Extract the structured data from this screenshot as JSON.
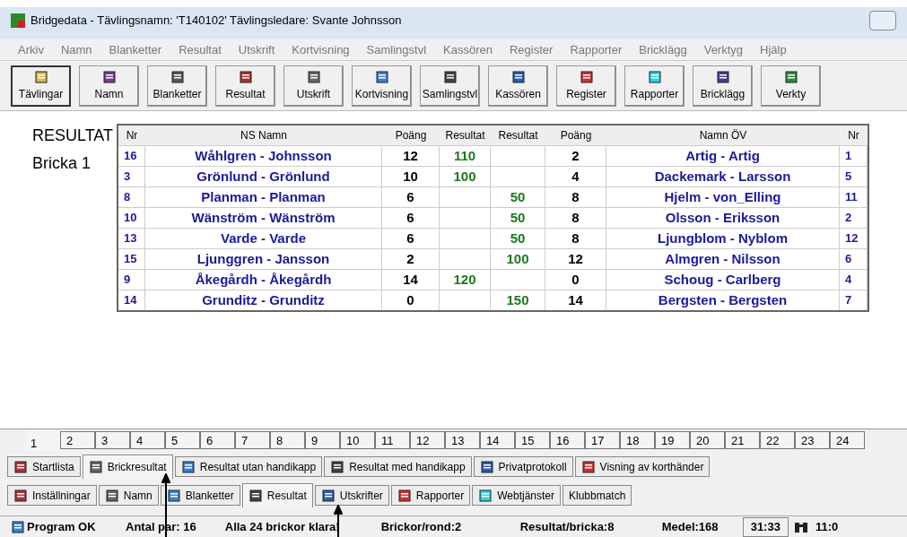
{
  "window": {
    "title": "Bridgedata - Tävlingsnamn: 'T140102' Tävlingsledare: Svante Johnsson"
  },
  "menu": [
    "Arkiv",
    "Namn",
    "Blanketter",
    "Resultat",
    "Utskrift",
    "Kortvisning",
    "Samlingstvl",
    "Kassören",
    "Register",
    "Rapporter",
    "Bricklägg",
    "Verktyg",
    "Hjälp"
  ],
  "toolbar": [
    {
      "label": "Tävlingar",
      "selected": true
    },
    {
      "label": "Namn",
      "selected": false
    },
    {
      "label": "Blanketter",
      "selected": false
    },
    {
      "label": "Resultat",
      "selected": false
    },
    {
      "label": "Utskrift",
      "selected": false
    },
    {
      "label": "Kortvisning",
      "selected": false
    },
    {
      "label": "Samlingstvl",
      "selected": false
    },
    {
      "label": "Kassören",
      "selected": false
    },
    {
      "label": "Register",
      "selected": false
    },
    {
      "label": "Rapporter",
      "selected": false
    },
    {
      "label": "Bricklägg",
      "selected": false
    },
    {
      "label": "Verkty",
      "selected": false
    }
  ],
  "heading": "RESULTAT",
  "board": "Bricka 1",
  "table": {
    "columns": [
      "Nr",
      "NS Namn",
      "Poäng",
      "Resultat",
      "Resultat",
      "Poäng",
      "Namn ÖV",
      "Nr"
    ],
    "rows": [
      {
        "ns_nr": "16",
        "ns_name": "Wåhlgren - Johnsson",
        "ns_points": "12",
        "ns_result": "110",
        "ew_points": "2",
        "ew_name": "Artig - Artig",
        "ew_nr": "1"
      },
      {
        "ns_nr": "3",
        "ns_name": "Grönlund - Grönlund",
        "ns_points": "10",
        "ns_result": "100",
        "ew_points": "4",
        "ew_name": "Dackemark - Larsson",
        "ew_nr": "5"
      },
      {
        "ns_nr": "8",
        "ns_name": "Planman - Planman",
        "ns_points": "6",
        "ew_result": "50",
        "ew_points": "8",
        "ew_name": "Hjelm - von_Elling",
        "ew_nr": "11"
      },
      {
        "ns_nr": "10",
        "ns_name": "Wänström - Wänström",
        "ns_points": "6",
        "ew_result": "50",
        "ew_points": "8",
        "ew_name": "Olsson - Eriksson",
        "ew_nr": "2"
      },
      {
        "ns_nr": "13",
        "ns_name": "Varde - Varde",
        "ns_points": "6",
        "ew_result": "50",
        "ew_points": "8",
        "ew_name": "Ljungblom - Nyblom",
        "ew_nr": "12"
      },
      {
        "ns_nr": "15",
        "ns_name": "Ljunggren - Jansson",
        "ns_points": "2",
        "ew_result": "100",
        "ew_points": "12",
        "ew_name": "Almgren - Nilsson",
        "ew_nr": "6"
      },
      {
        "ns_nr": "9",
        "ns_name": "Åkegårdh - Åkegårdh",
        "ns_points": "14",
        "ns_result": "120",
        "ew_points": "0",
        "ew_name": "Schoug - Carlberg",
        "ew_nr": "4"
      },
      {
        "ns_nr": "14",
        "ns_name": "Grunditz - Grunditz",
        "ns_points": "0",
        "ew_result": "150",
        "ew_points": "14",
        "ew_name": "Bergsten - Bergsten",
        "ew_nr": "7"
      }
    ]
  },
  "board_tabs": [
    {
      "label": "1",
      "selected": true
    },
    {
      "label": "2",
      "selected": false
    },
    {
      "label": "3",
      "selected": false
    },
    {
      "label": "4",
      "selected": false
    },
    {
      "label": "5",
      "selected": false
    },
    {
      "label": "6",
      "selected": false
    },
    {
      "label": "7",
      "selected": false
    },
    {
      "label": "8",
      "selected": false
    },
    {
      "label": "9",
      "selected": false
    },
    {
      "label": "10",
      "selected": false
    },
    {
      "label": "11",
      "selected": false
    },
    {
      "label": "12",
      "selected": false
    },
    {
      "label": "13",
      "selected": false
    },
    {
      "label": "14",
      "selected": false
    },
    {
      "label": "15",
      "selected": false
    },
    {
      "label": "16",
      "selected": false
    },
    {
      "label": "17",
      "selected": false
    },
    {
      "label": "18",
      "selected": false
    },
    {
      "label": "19",
      "selected": false
    },
    {
      "label": "20",
      "selected": false
    },
    {
      "label": "21",
      "selected": false
    },
    {
      "label": "22",
      "selected": false
    },
    {
      "label": "23",
      "selected": false
    },
    {
      "label": "24",
      "selected": false
    }
  ],
  "view_tabs": [
    {
      "label": "Startlista",
      "selected": false
    },
    {
      "label": "Brickresultat",
      "selected": true
    },
    {
      "label": "Resultat utan handikapp",
      "selected": false
    },
    {
      "label": "Resultat med handikapp",
      "selected": false
    },
    {
      "label": "Privatprotokoll",
      "selected": false
    },
    {
      "label": "Visning av korthänder",
      "selected": false
    }
  ],
  "section_tabs": [
    {
      "label": "Inställningar",
      "selected": false
    },
    {
      "label": "Namn",
      "selected": false
    },
    {
      "label": "Blanketter",
      "selected": false
    },
    {
      "label": "Resultat",
      "selected": true
    },
    {
      "label": "Utskrifter",
      "selected": false
    },
    {
      "label": "Rapporter",
      "selected": false
    },
    {
      "label": "Webtjänster",
      "selected": false
    },
    {
      "label": "Klubbmatch",
      "selected": false
    }
  ],
  "status_bar": {
    "status": "Program OK",
    "pairs": "Antal par: 16",
    "boards": "Alla 24 brickor klara!",
    "per_round": "Brickor/rond:2",
    "per_board": "Resultat/bricka:8",
    "average": "Medel:168",
    "time": "31:33",
    "clock": "11:0"
  }
}
